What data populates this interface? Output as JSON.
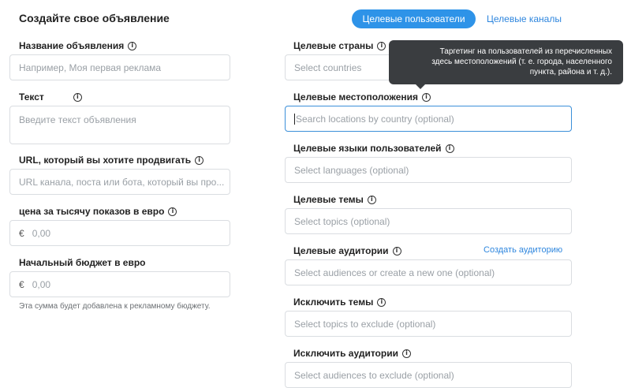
{
  "header": {
    "title": "Создайте свое объявление",
    "tab_active": "Целевые пользователи",
    "tab_other": "Целевые каналы"
  },
  "left": {
    "ad_name_label": "Название объявления",
    "ad_name_placeholder": "Например, Моя первая реклама",
    "text_label": "Текст",
    "text_placeholder": "Введите текст объявления",
    "url_label": "URL, который вы хотите продвигать",
    "url_placeholder": "URL канала, поста или бота, который вы про...",
    "cpm_label": "цена за тысячу показов в евро",
    "cpm_currency": "€",
    "cpm_value": "0,00",
    "budget_label": "Начальный бюджет в евро",
    "budget_currency": "€",
    "budget_value": "0,00",
    "budget_hint": "Эта сумма будет добавлена к рекламному бюджету."
  },
  "right": {
    "countries_label": "Целевые страны",
    "countries_placeholder": "Select countries",
    "locations_label": "Целевые местоположения",
    "locations_placeholder": "Search locations by country (optional)",
    "languages_label": "Целевые языки пользователей",
    "languages_placeholder": "Select languages (optional)",
    "topics_label": "Целевые темы",
    "topics_placeholder": "Select topics (optional)",
    "audiences_label": "Целевые аудитории",
    "create_audience_link": "Создать аудиторию",
    "audiences_placeholder": "Select audiences or create a new one (optional)",
    "exclude_topics_label": "Исключить темы",
    "exclude_topics_placeholder": "Select topics to exclude (optional)",
    "exclude_audiences_label": "Исключить аудитории",
    "exclude_audiences_placeholder": "Select audiences to exclude (optional)"
  },
  "tooltip": {
    "line1": "Таргетинг на пользователей из перечисленных",
    "line2": "здесь местоположений (т. е. города, населенного",
    "line3": "пункта, района и т. д.)."
  },
  "icons": {
    "info": "info-circle-icon"
  },
  "colors": {
    "accent": "#2e93e8",
    "link": "#2e86de",
    "tooltip_bg": "#3a3d40",
    "focus_border": "#3b8fd9"
  }
}
